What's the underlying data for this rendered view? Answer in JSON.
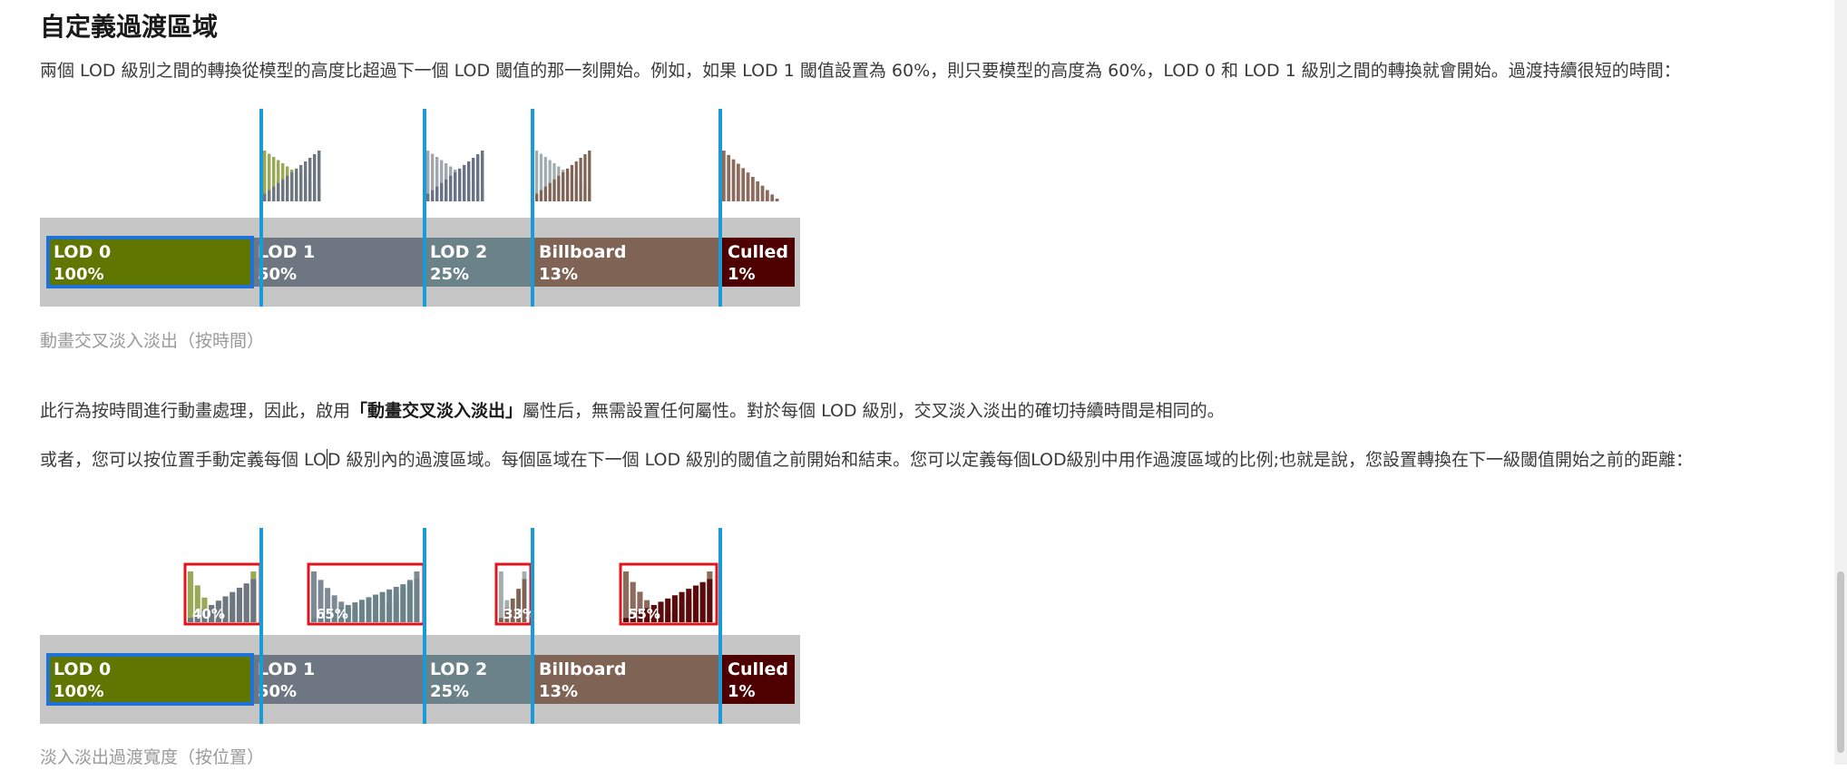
{
  "heading": "自定義過渡區域",
  "intro": "兩個 LOD 級別之間的轉換從模型的高度比超過下一個 LOD 閾值的那一刻開始。例如，如果 LOD 1 閾值設置為 60%，則只要模型的高度為 60%，LOD 0 和 LOD 1 級別之間的轉換就會開始。過渡持續很短的時間：",
  "figure1": {
    "caption": "動畫交叉淡入淡出（按時間）",
    "bands": [
      {
        "name": "LOD 0",
        "percent": "100%",
        "color": "#5f7600"
      },
      {
        "name": "LOD 1",
        "percent": "50%",
        "color": "#6e7781"
      },
      {
        "name": "LOD 2",
        "percent": "25%",
        "color": "#6a8288"
      },
      {
        "name": "Billboard",
        "percent": "13%",
        "color": "#7f6456"
      },
      {
        "name": "Culled",
        "percent": "1%",
        "color": "#4e0000"
      }
    ]
  },
  "para2": {
    "before": "此行為按時間進行動畫處理，因此，啟用",
    "emphasis": "「動畫交叉淡入淡出」",
    "after": "屬性后，無需設置任何屬性。對於每個 LOD 級別，交叉淡入淡出的確切持續時間是相同的。"
  },
  "para3": {
    "before_caret": "或者，您可以按位置手動定義每個 LO",
    "after_caret": "D 級別內的過渡區域。每個區域在下一個 LOD 級別的閾值之前開始和結束。您可以定義每個LOD級別中用作過渡區域的比例;也就是說，您設置轉換在下一級閾值開始之前的距離："
  },
  "figure2": {
    "caption": "淡入淡出過渡寬度（按位置）",
    "transition_labels": [
      "40%",
      "65%",
      "33%",
      "55%"
    ],
    "bands": [
      {
        "name": "LOD 0",
        "percent": "100%",
        "color": "#5f7600"
      },
      {
        "name": "LOD 1",
        "percent": "50%",
        "color": "#6e7781"
      },
      {
        "name": "LOD 2",
        "percent": "25%",
        "color": "#6a8288"
      },
      {
        "name": "Billboard",
        "percent": "13%",
        "color": "#7f6456"
      },
      {
        "name": "Culled",
        "percent": "1%",
        "color": "#4e0000"
      }
    ]
  },
  "colors": {
    "threshold_line": "#1a9ad6",
    "current_lod_outline": "#1f72d6",
    "transition_box": "#e0141b",
    "bar_background": "#c6c6c6"
  }
}
